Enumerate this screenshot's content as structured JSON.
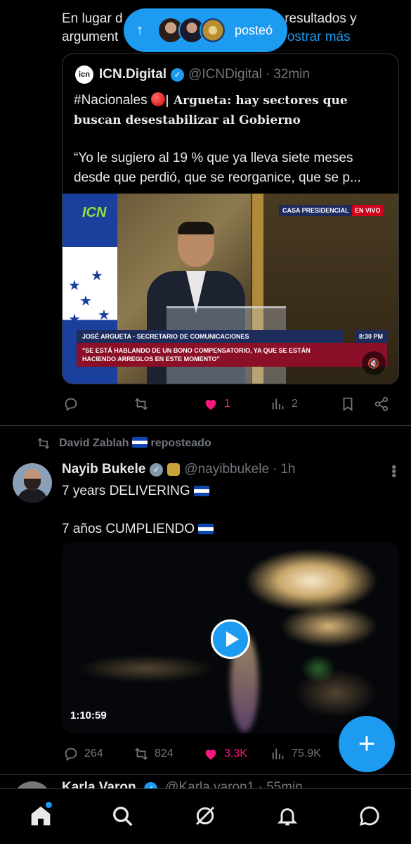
{
  "top_tweet": {
    "text_prefix": "En lugar d",
    "text_suffix": "resultados y",
    "text_line2": "argument",
    "show_more": "ostrar más"
  },
  "new_posts_pill": {
    "label": "posteó"
  },
  "quote": {
    "name": "ICN.Digital",
    "handle": "@ICNDigital",
    "separator": "·",
    "time": "32min",
    "logo_text": "icn",
    "hashtag": "#Nacionales",
    "headline": "| Argueta: hay sectores que buscan desestabilizar al Gobierno",
    "quote_line1": "“Yo le sugiero al 19 % que ya lleva siete meses",
    "quote_line2": "desde que perdió, que se reorganice, que se p...",
    "video": {
      "logo": "ICN",
      "casa": "CASA PRESIDENCIAL",
      "live": "EN VIVO",
      "lower_name": "JOSÉ ARGUETA - SECRETARIO DE COMUNICACIONES",
      "time": "8:30 PM",
      "lower_quote": "\"SE ESTÁ HABLANDO DE UN BONO COMPENSATORIO, YA QUE SE ESTÁN HACIENDO ARREGLOS EN ESTE MOMENTO\""
    }
  },
  "tweet1_actions": {
    "replies": "",
    "reposts": "",
    "likes": "1",
    "views": "2"
  },
  "repost_line": {
    "user": "David Zablah",
    "suffix": "reposteado"
  },
  "tweet2": {
    "name": "Nayib Bukele",
    "handle": "@nayibbukele",
    "separator": "·",
    "time": "1h",
    "line1": "7 years DELIVERING",
    "line2": "7 años CUMPLIENDO",
    "video_duration": "1:10:59",
    "actions": {
      "replies": "264",
      "reposts": "824",
      "likes": "3.3K",
      "views": "75.9K"
    }
  },
  "next_tweet": {
    "name": "Karla Varon",
    "handle": "@Karla.varon1 · 55min"
  },
  "fab": {
    "label": "+"
  },
  "colors": {
    "accent": "#1d9bf0",
    "like": "#f91880",
    "muted": "#71767b",
    "background": "#000000"
  },
  "nav": {
    "items": [
      "home-icon",
      "search-icon",
      "grok-icon",
      "notifications-icon",
      "messages-icon"
    ]
  }
}
